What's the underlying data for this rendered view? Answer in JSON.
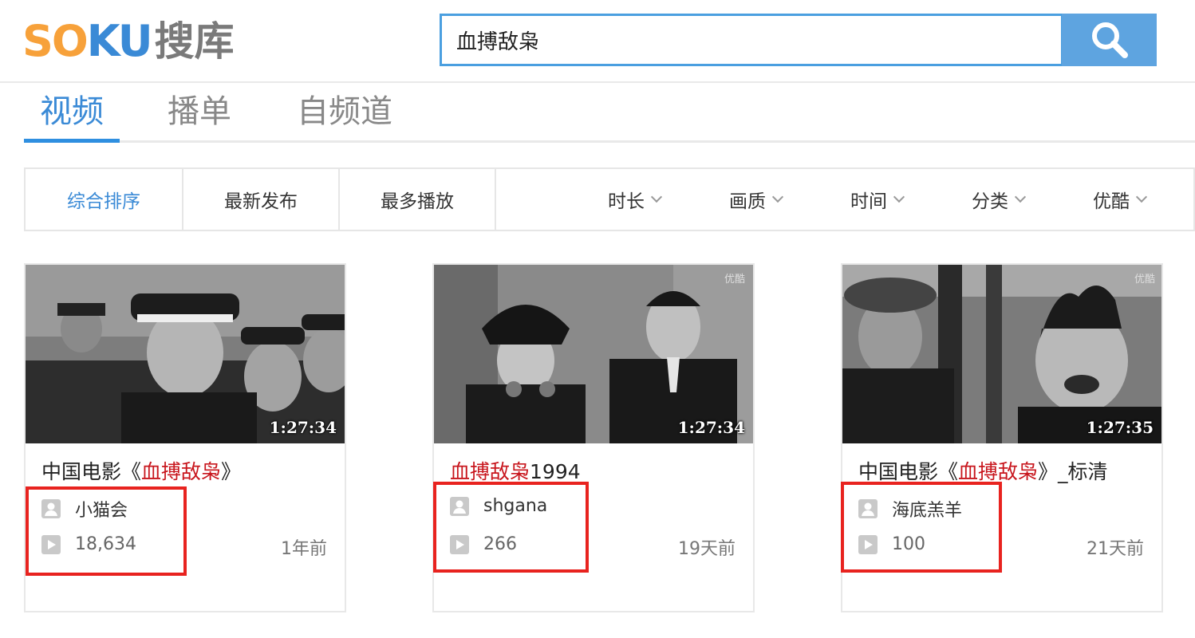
{
  "header": {
    "logo_text": "SOKU",
    "logo_cn": "搜库",
    "search_value": "血搏敌枭",
    "colors": {
      "logo_orange": "#f7a13a",
      "logo_blue": "#3a8ad6",
      "search_border": "#4a9fe0",
      "search_button": "#5ea4e0"
    }
  },
  "tabs": [
    {
      "label": "视频",
      "active": true
    },
    {
      "label": "播单",
      "active": false
    },
    {
      "label": "自频道",
      "active": false
    }
  ],
  "sort": [
    {
      "label": "综合排序",
      "active": true
    },
    {
      "label": "最新发布",
      "active": false
    },
    {
      "label": "最多播放",
      "active": false
    }
  ],
  "filters": [
    {
      "label": "时长"
    },
    {
      "label": "画质"
    },
    {
      "label": "时间"
    },
    {
      "label": "分类"
    },
    {
      "label": "优酷"
    }
  ],
  "videos": [
    {
      "title_pre": "中国电影《",
      "title_hl": "血搏敌枭",
      "title_post": "》",
      "duration": "1:27:34",
      "uploader": "小猫会",
      "plays": "18,634",
      "ago": "1年前",
      "highlighted": true
    },
    {
      "title_pre": "",
      "title_hl": "血搏敌枭",
      "title_post": "1994",
      "duration": "1:27:34",
      "uploader": "shgana",
      "plays": "266",
      "ago": "19天前",
      "highlighted": true
    },
    {
      "title_pre": "中国电影《",
      "title_hl": "血搏敌枭",
      "title_post": "》_标清",
      "duration": "1:27:35",
      "uploader": "海底羔羊",
      "plays": "100",
      "ago": "21天前",
      "highlighted": true
    }
  ],
  "icons": {
    "search": "search-icon",
    "user": "user-icon",
    "play": "play-icon",
    "chevron": "chevron-down-icon"
  },
  "highlight_color": "#c8161d",
  "annotation_color": "#e8231f"
}
